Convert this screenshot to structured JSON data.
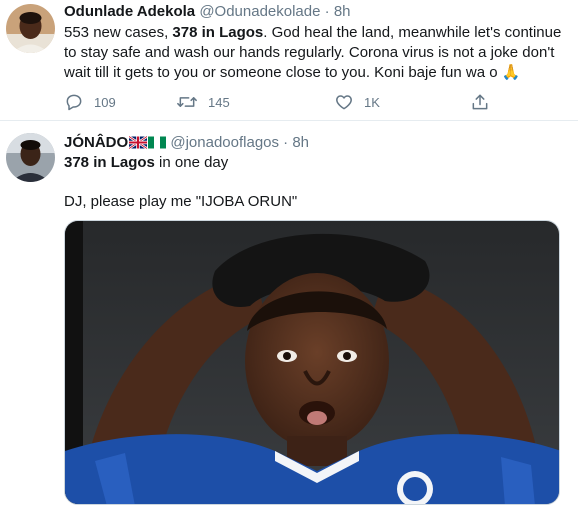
{
  "tweets": [
    {
      "name": "Odunlade Adekola",
      "handle": "@Odunadekolade",
      "separator": "·",
      "time": "8h",
      "text_parts": [
        "553 new cases, ",
        "378 in Lagos",
        ". God heal the land, meanwhile let's continue to stay safe and wash our hands regularly. Corona virus is not a joke don't wait till it gets to you or someone close to you.  Koni baje fun wa o ",
        "🙏"
      ],
      "replies": "109",
      "retweets": "145",
      "likes": "1K"
    },
    {
      "name": "JÓNÂDO",
      "name_flags": [
        "uk-flag",
        "nigeria-flag"
      ],
      "handle": "@jonadooflagos",
      "separator": "·",
      "time": "8h",
      "line1_parts": [
        "378 in Lagos",
        " in one day"
      ],
      "line2": "DJ, please play me \"IJOBA ORUN\""
    }
  ],
  "icons": [
    "reply-icon",
    "retweet-icon",
    "like-icon",
    "share-icon"
  ],
  "colors": {
    "text": "#14171a",
    "secondary": "#657786",
    "divider": "#e6ecf0",
    "jersey_blue": "#1d4fa8"
  }
}
